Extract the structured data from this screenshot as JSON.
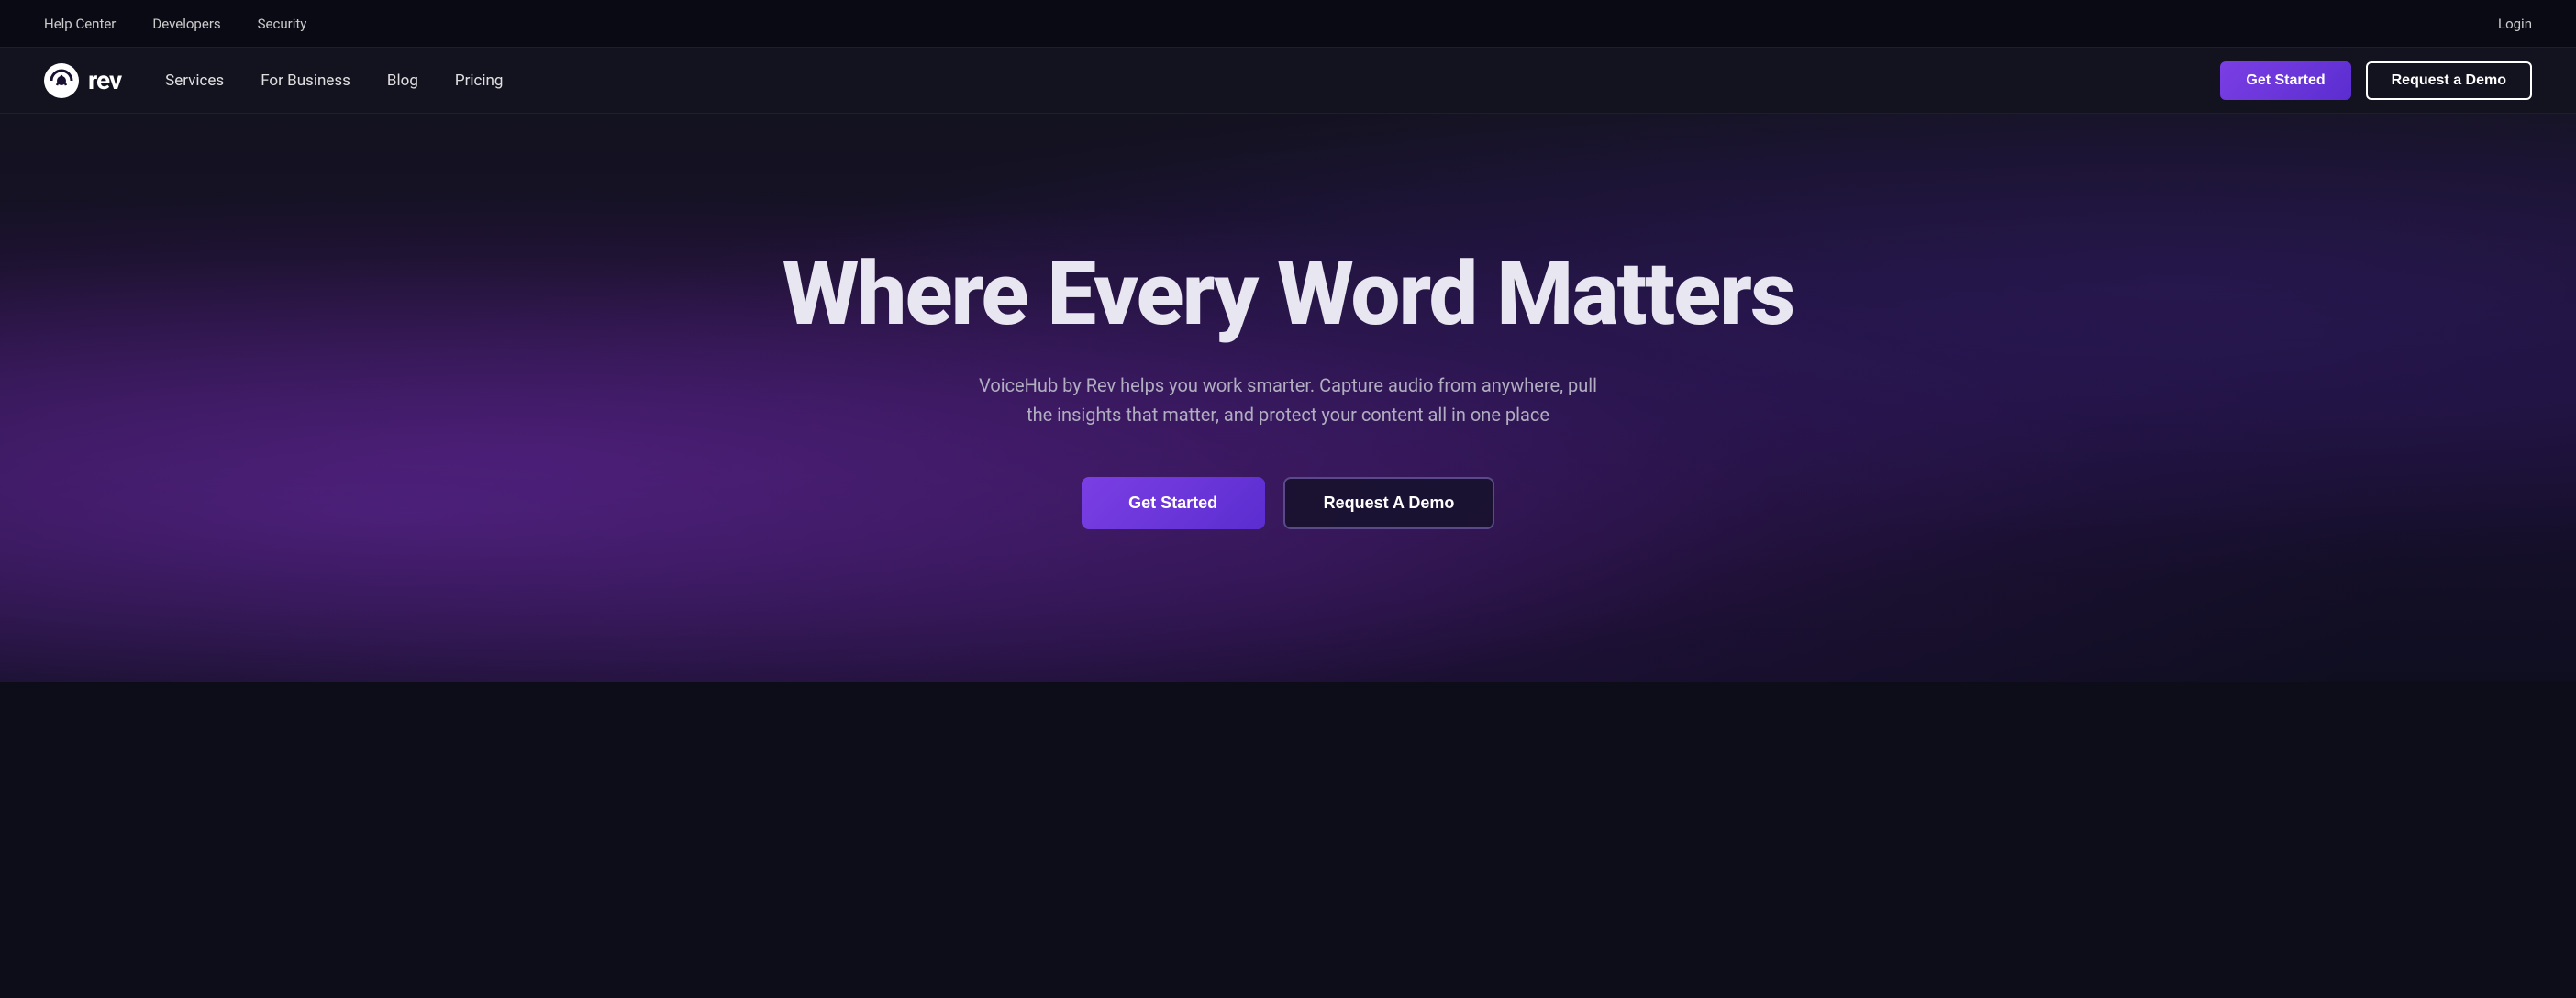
{
  "topBar": {
    "links": [
      {
        "id": "help-center",
        "label": "Help Center"
      },
      {
        "id": "developers",
        "label": "Developers"
      },
      {
        "id": "security",
        "label": "Security"
      }
    ],
    "loginLabel": "Login"
  },
  "mainNav": {
    "logo": {
      "text": "rev"
    },
    "links": [
      {
        "id": "services",
        "label": "Services"
      },
      {
        "id": "for-business",
        "label": "For Business"
      },
      {
        "id": "blog",
        "label": "Blog"
      },
      {
        "id": "pricing",
        "label": "Pricing"
      }
    ],
    "getStartedLabel": "Get Started",
    "requestDemoLabel": "Request a Demo"
  },
  "hero": {
    "title": "Where Every Word Matters",
    "subtitle": "VoiceHub by Rev helps you work smarter. Capture audio from anywhere, pull the insights that matter, and protect your content all in one place",
    "getStartedLabel": "Get Started",
    "requestDemoLabel": "Request A Demo"
  },
  "colors": {
    "accent": "#7b3fe4",
    "accentDark": "#5b2dd0",
    "topBarBg": "#0a0a14",
    "navBg": "#13121f",
    "heroBg": "#1a1030"
  }
}
